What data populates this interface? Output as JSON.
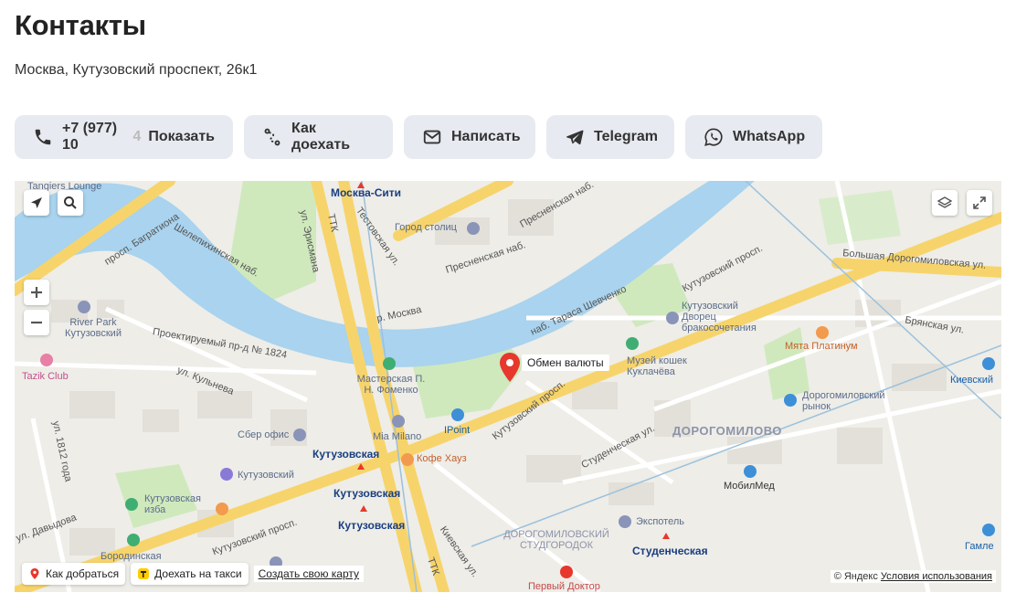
{
  "page": {
    "title": "Контакты",
    "address": "Москва, Кутузовский проспект, 26к1"
  },
  "actions": {
    "phone_visible": "+7 (977) 10",
    "phone_fade": "4",
    "phone_show": "Показать",
    "route": "Как доехать",
    "write": "Написать",
    "telegram": "Telegram",
    "whatsapp": "WhatsApp"
  },
  "map": {
    "marker_label": "Обмен валюты",
    "labels": {
      "tangiers": "Tangiers Lounge",
      "moscow_city": "Москва-Сити",
      "gorod_stolic": "Город столиц",
      "bagrationa": "просп. Багратиона",
      "erismana": "ул. Эрисмана",
      "ttk": "ТТК",
      "testovskaya": "Тестовская ул.",
      "presnenskaya1": "Пресненская наб.",
      "presnenskaya2": "Пресненская наб.",
      "shelepikhinskaya": "Шелепихинская наб.",
      "kutuzovsky_top": "Кутузовский просп.",
      "bolshaya_dorogo": "Большая Дорогомиловская ул.",
      "river": "р. Москва",
      "taras": "наб. Тараса Шевченко",
      "kutuzovsky_dvorec": "Кутузовский Дворец бракосочетания",
      "bryanskaya": "Брянская ул.",
      "myata": "Мята Платинум",
      "river_park": "River Park Кутузовский",
      "proektiruemy": "Проектируемый пр-д № 1824",
      "tazik": "Tazik Club",
      "kulneva": "ул. Кульнева",
      "masterskaya": "Мастерская П. Н. Фоменко",
      "koshek": "Музей кошек Куклачёва",
      "kievsky": "Киевский",
      "dorogomilovsky_rynok": "Дорогомиловский рынок",
      "dorogomilovo": "ДОРОГОМИЛОВО",
      "ul1812": "ул. 1812 года",
      "sber": "Сбер офис",
      "mia": "Mia Milano",
      "ipoint": "IPoint",
      "kutuzovsky_mcd": "Кутузовская",
      "kofe": "Кофе Хауз",
      "kutuzovsky_metro4": "Кутузовская",
      "kutuzovsky_shop": "Кутузовский",
      "studencheskaya_ul": "Студенческая ул.",
      "kutuzovsky_prosp_mid": "Кутузовский просп.",
      "mobilmed": "МобилМед",
      "kutuzovsky_izba": "Кутузовская изба",
      "kutuzovsky_metro14": "Кутузовская",
      "kutuzovsky_prosp_low": "Кутузовский просп.",
      "davydova": "ул. Давыдова",
      "dorogomilovsky_studgorodok": "ДОРОГОМИЛОВСКИЙ СТУДГОРОДОК",
      "expotel": "Экспотель",
      "studencheskaya": "Студенческая",
      "borodinskaya": "Бородинская",
      "kievskaya_ul": "Киевская ул.",
      "gamleys": "Гамле",
      "perviy_doktor": "Первый Доктор",
      "ttk_low": "ТТК"
    },
    "bottom": {
      "route": "Как добраться",
      "taxi": "Доехать на такси",
      "create": "Создать свою карту"
    },
    "copyright": "© Яндекс",
    "terms": "Условия использования"
  },
  "colors": {
    "button_bg": "#e7eaf0",
    "water": "#a9d3ee",
    "park": "#cdeab8",
    "road_major": "#f9d66a",
    "marker": "#e8372c"
  },
  "icons": [
    "phone-icon",
    "route-icon",
    "mail-icon",
    "telegram-icon",
    "whatsapp-icon",
    "locate-icon",
    "search-icon",
    "zoom-in-icon",
    "zoom-out-icon",
    "layers-icon",
    "fullscreen-icon",
    "map-marker-icon",
    "pin-icon",
    "taxi-icon"
  ]
}
